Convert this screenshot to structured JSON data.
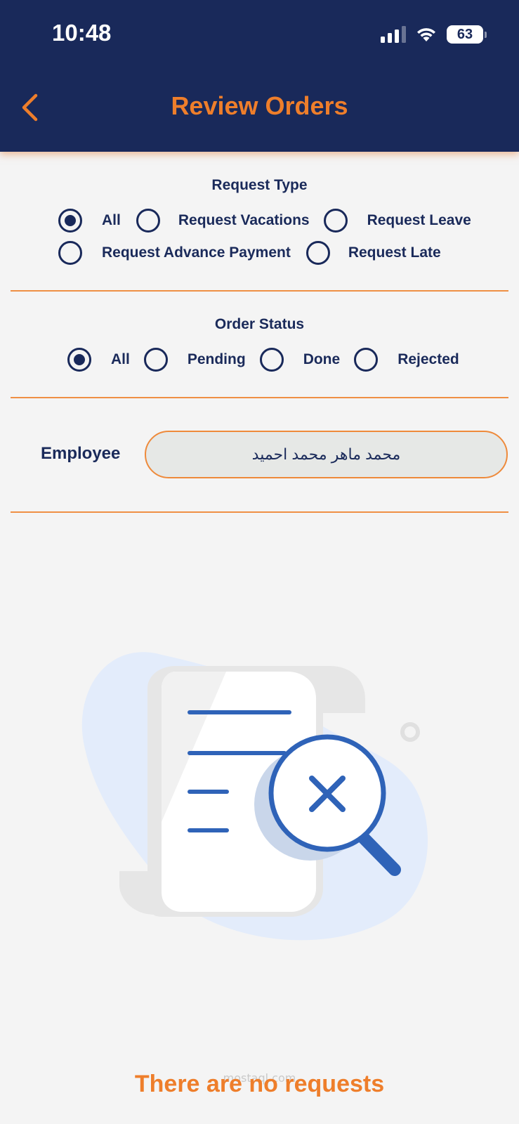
{
  "status_bar": {
    "time": "10:48",
    "battery": "63",
    "icons": [
      "cellular-signal-icon",
      "wifi-icon",
      "battery-icon"
    ]
  },
  "header": {
    "title": "Review Orders",
    "back_icon": "chevron-left-icon"
  },
  "request_type": {
    "title": "Request Type",
    "options": [
      {
        "label": "All",
        "selected": true
      },
      {
        "label": "Request Vacations",
        "selected": false
      },
      {
        "label": "Request Leave",
        "selected": false
      },
      {
        "label": "Request Advance Payment",
        "selected": false
      },
      {
        "label": "Request Late",
        "selected": false
      }
    ]
  },
  "order_status": {
    "title": "Order Status",
    "options": [
      {
        "label": "All",
        "selected": true
      },
      {
        "label": "Pending",
        "selected": false
      },
      {
        "label": "Done",
        "selected": false
      },
      {
        "label": "Rejected",
        "selected": false
      }
    ]
  },
  "employee": {
    "label": "Employee",
    "value": "محمد ماهر محمد احميد"
  },
  "empty_state": {
    "icon": "no-results-document-search-icon",
    "message": "There are no requests",
    "watermark": "mostaql.com"
  },
  "colors": {
    "header_bg": "#19295a",
    "accent": "#ee7e2b",
    "page_bg": "#f4f4f4",
    "illustration_blue": "#2f63b8",
    "illustration_bg": "#e3ecfb"
  }
}
